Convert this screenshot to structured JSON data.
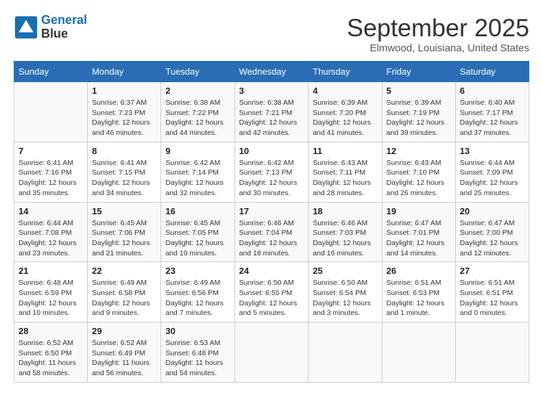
{
  "header": {
    "logo_line1": "General",
    "logo_line2": "Blue",
    "month": "September 2025",
    "location": "Elmwood, Louisiana, United States"
  },
  "days_of_week": [
    "Sunday",
    "Monday",
    "Tuesday",
    "Wednesday",
    "Thursday",
    "Friday",
    "Saturday"
  ],
  "weeks": [
    [
      {
        "num": "",
        "sunrise": "",
        "sunset": "",
        "daylight": ""
      },
      {
        "num": "1",
        "sunrise": "Sunrise: 6:37 AM",
        "sunset": "Sunset: 7:23 PM",
        "daylight": "Daylight: 12 hours and 46 minutes."
      },
      {
        "num": "2",
        "sunrise": "Sunrise: 6:38 AM",
        "sunset": "Sunset: 7:22 PM",
        "daylight": "Daylight: 12 hours and 44 minutes."
      },
      {
        "num": "3",
        "sunrise": "Sunrise: 6:38 AM",
        "sunset": "Sunset: 7:21 PM",
        "daylight": "Daylight: 12 hours and 42 minutes."
      },
      {
        "num": "4",
        "sunrise": "Sunrise: 6:39 AM",
        "sunset": "Sunset: 7:20 PM",
        "daylight": "Daylight: 12 hours and 41 minutes."
      },
      {
        "num": "5",
        "sunrise": "Sunrise: 6:39 AM",
        "sunset": "Sunset: 7:19 PM",
        "daylight": "Daylight: 12 hours and 39 minutes."
      },
      {
        "num": "6",
        "sunrise": "Sunrise: 6:40 AM",
        "sunset": "Sunset: 7:17 PM",
        "daylight": "Daylight: 12 hours and 37 minutes."
      }
    ],
    [
      {
        "num": "7",
        "sunrise": "Sunrise: 6:41 AM",
        "sunset": "Sunset: 7:16 PM",
        "daylight": "Daylight: 12 hours and 35 minutes."
      },
      {
        "num": "8",
        "sunrise": "Sunrise: 6:41 AM",
        "sunset": "Sunset: 7:15 PM",
        "daylight": "Daylight: 12 hours and 34 minutes."
      },
      {
        "num": "9",
        "sunrise": "Sunrise: 6:42 AM",
        "sunset": "Sunset: 7:14 PM",
        "daylight": "Daylight: 12 hours and 32 minutes."
      },
      {
        "num": "10",
        "sunrise": "Sunrise: 6:42 AM",
        "sunset": "Sunset: 7:13 PM",
        "daylight": "Daylight: 12 hours and 30 minutes."
      },
      {
        "num": "11",
        "sunrise": "Sunrise: 6:43 AM",
        "sunset": "Sunset: 7:11 PM",
        "daylight": "Daylight: 12 hours and 28 minutes."
      },
      {
        "num": "12",
        "sunrise": "Sunrise: 6:43 AM",
        "sunset": "Sunset: 7:10 PM",
        "daylight": "Daylight: 12 hours and 26 minutes."
      },
      {
        "num": "13",
        "sunrise": "Sunrise: 6:44 AM",
        "sunset": "Sunset: 7:09 PM",
        "daylight": "Daylight: 12 hours and 25 minutes."
      }
    ],
    [
      {
        "num": "14",
        "sunrise": "Sunrise: 6:44 AM",
        "sunset": "Sunset: 7:08 PM",
        "daylight": "Daylight: 12 hours and 23 minutes."
      },
      {
        "num": "15",
        "sunrise": "Sunrise: 6:45 AM",
        "sunset": "Sunset: 7:06 PM",
        "daylight": "Daylight: 12 hours and 21 minutes."
      },
      {
        "num": "16",
        "sunrise": "Sunrise: 6:45 AM",
        "sunset": "Sunset: 7:05 PM",
        "daylight": "Daylight: 12 hours and 19 minutes."
      },
      {
        "num": "17",
        "sunrise": "Sunrise: 6:46 AM",
        "sunset": "Sunset: 7:04 PM",
        "daylight": "Daylight: 12 hours and 18 minutes."
      },
      {
        "num": "18",
        "sunrise": "Sunrise: 6:46 AM",
        "sunset": "Sunset: 7:03 PM",
        "daylight": "Daylight: 12 hours and 16 minutes."
      },
      {
        "num": "19",
        "sunrise": "Sunrise: 6:47 AM",
        "sunset": "Sunset: 7:01 PM",
        "daylight": "Daylight: 12 hours and 14 minutes."
      },
      {
        "num": "20",
        "sunrise": "Sunrise: 6:47 AM",
        "sunset": "Sunset: 7:00 PM",
        "daylight": "Daylight: 12 hours and 12 minutes."
      }
    ],
    [
      {
        "num": "21",
        "sunrise": "Sunrise: 6:48 AM",
        "sunset": "Sunset: 6:59 PM",
        "daylight": "Daylight: 12 hours and 10 minutes."
      },
      {
        "num": "22",
        "sunrise": "Sunrise: 6:49 AM",
        "sunset": "Sunset: 6:58 PM",
        "daylight": "Daylight: 12 hours and 9 minutes."
      },
      {
        "num": "23",
        "sunrise": "Sunrise: 6:49 AM",
        "sunset": "Sunset: 6:56 PM",
        "daylight": "Daylight: 12 hours and 7 minutes."
      },
      {
        "num": "24",
        "sunrise": "Sunrise: 6:50 AM",
        "sunset": "Sunset: 6:55 PM",
        "daylight": "Daylight: 12 hours and 5 minutes."
      },
      {
        "num": "25",
        "sunrise": "Sunrise: 6:50 AM",
        "sunset": "Sunset: 6:54 PM",
        "daylight": "Daylight: 12 hours and 3 minutes."
      },
      {
        "num": "26",
        "sunrise": "Sunrise: 6:51 AM",
        "sunset": "Sunset: 6:53 PM",
        "daylight": "Daylight: 12 hours and 1 minute."
      },
      {
        "num": "27",
        "sunrise": "Sunrise: 6:51 AM",
        "sunset": "Sunset: 6:51 PM",
        "daylight": "Daylight: 12 hours and 0 minutes."
      }
    ],
    [
      {
        "num": "28",
        "sunrise": "Sunrise: 6:52 AM",
        "sunset": "Sunset: 6:50 PM",
        "daylight": "Daylight: 11 hours and 58 minutes."
      },
      {
        "num": "29",
        "sunrise": "Sunrise: 6:52 AM",
        "sunset": "Sunset: 6:49 PM",
        "daylight": "Daylight: 11 hours and 56 minutes."
      },
      {
        "num": "30",
        "sunrise": "Sunrise: 6:53 AM",
        "sunset": "Sunset: 6:48 PM",
        "daylight": "Daylight: 11 hours and 54 minutes."
      },
      {
        "num": "",
        "sunrise": "",
        "sunset": "",
        "daylight": ""
      },
      {
        "num": "",
        "sunrise": "",
        "sunset": "",
        "daylight": ""
      },
      {
        "num": "",
        "sunrise": "",
        "sunset": "",
        "daylight": ""
      },
      {
        "num": "",
        "sunrise": "",
        "sunset": "",
        "daylight": ""
      }
    ]
  ]
}
